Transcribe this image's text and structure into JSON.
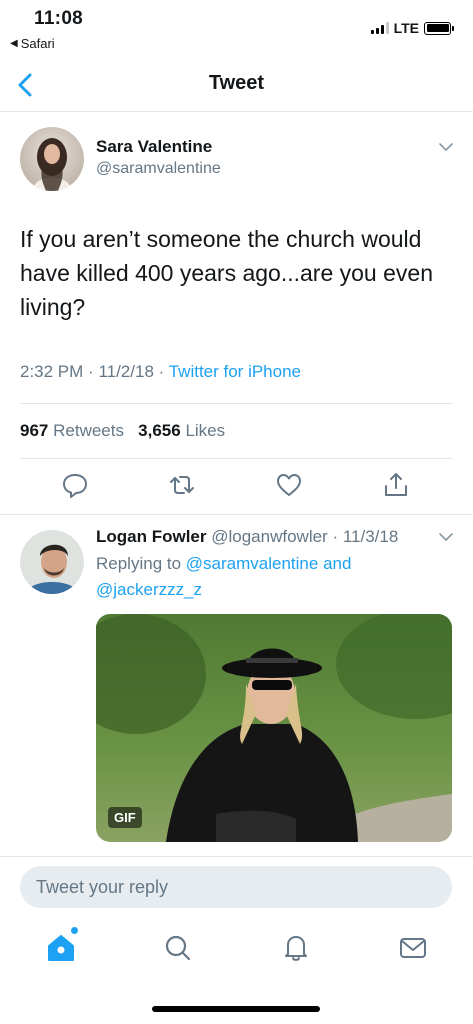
{
  "status_bar": {
    "time": "11:08",
    "back_app": "Safari",
    "network": "LTE"
  },
  "nav": {
    "title": "Tweet",
    "back_icon": "chevron-left-icon"
  },
  "tweet": {
    "author_name": "Sara Valentine",
    "author_handle": "@saramvalentine",
    "text": "If you aren’t someone the church would have killed 400 years ago...are you even living?",
    "time": "2:32 PM",
    "date": "11/2/18",
    "source": "Twitter for iPhone",
    "retweets_count": "967",
    "retweets_label": "Retweets",
    "likes_count": "3,656",
    "likes_label": "Likes"
  },
  "reply": {
    "author_name": "Logan Fowler",
    "author_handle": "@loganwfowler",
    "date": "11/3/18",
    "replying_prefix": "Replying to",
    "mention_1": "@saramvalentine",
    "conjunction": "and",
    "mention_2": "@jackerzzz_z",
    "media_badge": "GIF"
  },
  "composer": {
    "placeholder": "Tweet your reply"
  },
  "tab_bar": {
    "items": [
      "home-icon",
      "search-icon",
      "notifications-icon",
      "messages-icon"
    ],
    "active": "home-icon"
  },
  "colors": {
    "accent": "#1da1f2",
    "secondary_text": "#657786",
    "divider": "#e1e8ed"
  }
}
